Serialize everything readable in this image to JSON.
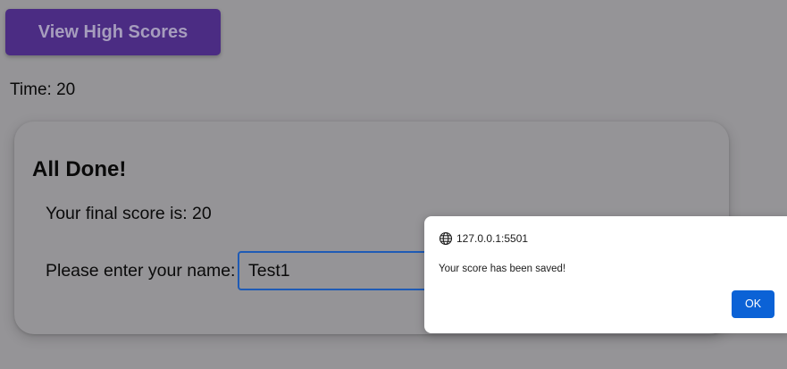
{
  "header": {
    "high_scores_label": "View High Scores"
  },
  "timer": {
    "text": "Time: 20"
  },
  "result_card": {
    "title": "All Done!",
    "score_text": "Your final score is: 20",
    "name_label": "Please enter your name:",
    "name_value": "Test1"
  },
  "alert_dialog": {
    "origin_icon": "globe-icon",
    "origin": "127.0.0.1:5501",
    "message": "Your score has been saved!",
    "ok_label": "OK"
  },
  "colors": {
    "page_bg": "#959497",
    "button_bg": "#4b2c83",
    "input_border": "#1f5bb5",
    "ok_button": "#0b62d6"
  }
}
